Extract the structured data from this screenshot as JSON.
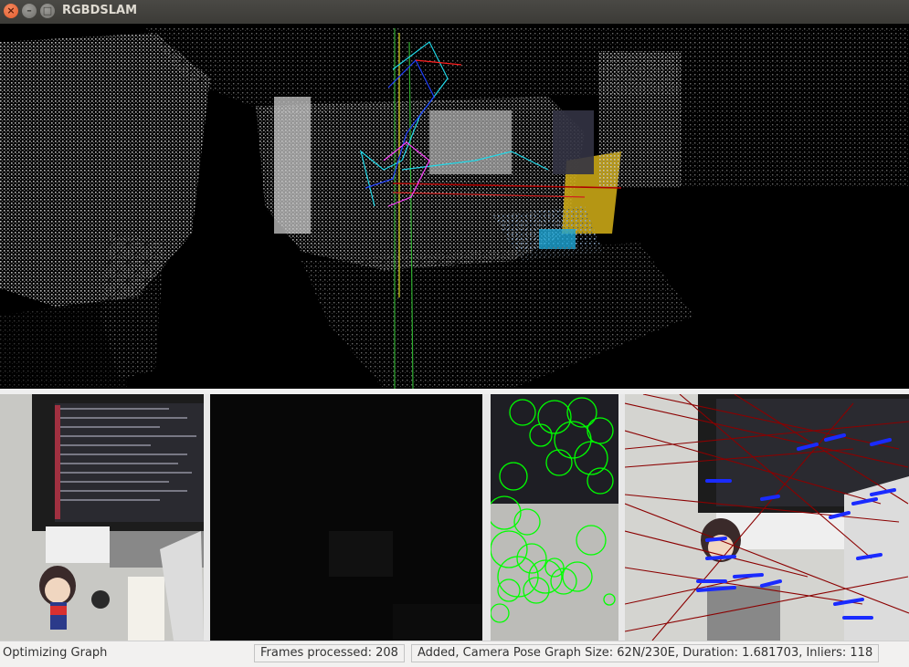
{
  "window": {
    "title": "RGBDSLAM",
    "controls": {
      "close": "×",
      "minimize": "–",
      "maximize": "□"
    }
  },
  "status": {
    "message": "Optimizing Graph",
    "frames": "Frames processed: 208",
    "graph": "Added, Camera Pose Graph Size: 62N/230E, Duration: 1.681703, Inliers:  118"
  },
  "colors": {
    "feature_circle": "#00ff00",
    "match_line": "#8b0000",
    "match_arrow": "#1a2bff",
    "statusbar_bg": "#f2f1f0"
  }
}
